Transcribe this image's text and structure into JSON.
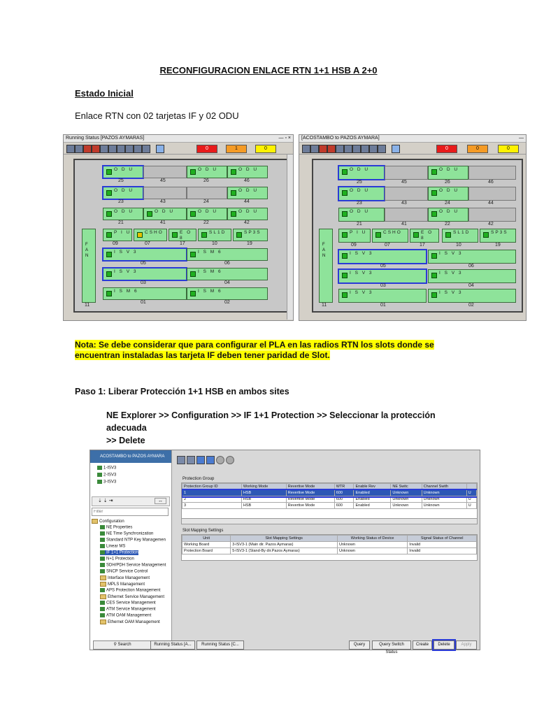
{
  "doc": {
    "title": "RECONFIGURACION ENLACE RTN 1+1 HSB A 2+0",
    "section1": "Estado Inicial",
    "para1": "Enlace RTN con 02 tarjetas IF y 02 ODU",
    "nota_line1": "Nota: Se debe considerar que para configurar el PLA en las radios RTN los slots donde se",
    "nota_line2": "encuentran instaladas las tarjeta IF deben tener paridad de Slot.",
    "paso1": "Paso 1: Liberar Protección 1+1 HSB en ambos sites",
    "nav_line1": "NE Explorer >> Configuration >> IF 1+1 Protection >> Seleccionar la protección adecuada",
    "nav_line2": ">> Delete"
  },
  "left_panel": {
    "title": "Running Status [PAZOS AYMARAS]",
    "controls": "— ▫ ×",
    "alarm_counts": [
      "0",
      "1",
      "0"
    ],
    "fan_label": "F A N",
    "slot_11": "11",
    "cards": {
      "c25": "O D U",
      "n25": "25",
      "n45": "45",
      "c26": "O D U",
      "n26": "26",
      "c46": "O D U",
      "n46": "46",
      "c23": "O D U",
      "n23": "23",
      "n43": "43",
      "n24": "24",
      "c44": "O D U",
      "n44": "44",
      "c21": "O D U",
      "n21": "21",
      "c41": "O D U",
      "n41": "41",
      "c22": "O D U",
      "n22": "22",
      "c42": "O D U",
      "n42": "42",
      "c09": "P I U",
      "n09": "09",
      "c07": "CSHO",
      "n07": "07",
      "c17": "E O 8",
      "n17": "17",
      "c10": "SL1D",
      "n10": "10",
      "c19": "SP3S",
      "n19": "19",
      "c05": "I S V 3",
      "n05": "05",
      "c06": "I S M 6",
      "n06": "06",
      "c03": "I S V 3",
      "n03": "03",
      "c04": "I S M 6",
      "n04": "04",
      "c01": "I S M 6",
      "n01": "01",
      "c02": "I S M 6",
      "n02": "02"
    }
  },
  "right_panel": {
    "title": "[ACOSTAMBO to PAZOS AYMARA]",
    "controls": "—",
    "alarm_counts": [
      "0",
      "0",
      "0"
    ],
    "fan_label": "F A N",
    "slot_11": "11",
    "cards": {
      "c25": "O D U",
      "n25": "25",
      "n45": "45",
      "c26": "O D U",
      "n26": "26",
      "n46": "46",
      "c23": "O D U",
      "n23": "23",
      "n43": "43",
      "c24": "O D U",
      "n24": "24",
      "n44": "44",
      "c21": "O D U",
      "n21": "21",
      "n41": "41",
      "c22": "O D U",
      "n22": "22",
      "n42": "42",
      "c09": "P I U",
      "n09": "09",
      "c07": "CSHO",
      "n07": "07",
      "c17": "E O 8",
      "n17": "17",
      "c10": "SL1D",
      "n10": "10",
      "c19": "SP3S",
      "n19": "19",
      "c05": "I S V 3",
      "n05": "05",
      "c06": "I S V 3",
      "n06": "06",
      "c03": "I S V 3",
      "n03": "03",
      "c04": "I S V 3",
      "n04": "04",
      "c01": "I S V 3",
      "n01": "01",
      "c02": "I S V 3",
      "n02": "02"
    }
  },
  "nms": {
    "ne_name": "ACOSTAMBO to PAZOS AYMARA",
    "boards": [
      "1-ISV3",
      "2-ISV3",
      "3-ISV3"
    ],
    "filter_placeholder": "Filter",
    "tree": [
      "Configuration",
      "NE Properties",
      "NE Time Synchronization",
      "Standard NTP Key Managemen",
      "Linear MS",
      "IF 1+1 Protection",
      "N+1 Protection",
      "SDH/PDH Service Management",
      "SNCP Service Control",
      "Interface Management",
      "MPLS Management",
      "APS Protection Management",
      "Ethernet Service Management",
      "CES Service Management",
      "ATM Service Management",
      "ATM OAM Management",
      "Ethernet OAM Management"
    ],
    "pg_label": "Protection Group",
    "pg_headers": [
      "Protection Group ID",
      "Working Mode",
      "Revertive Mode",
      "WTR",
      "Enable Rev",
      "NE Switc",
      "Channel Swith",
      ""
    ],
    "pg_rows": [
      [
        "1",
        "HSB",
        "Revertive Mode",
        "600",
        "Enabled",
        "Unknown",
        "Unknown",
        "U"
      ],
      [
        "2",
        "HSB",
        "Revertive Mode",
        "600",
        "Enabled",
        "Unknown",
        "Unknown",
        "U"
      ],
      [
        "3",
        "HSB",
        "Revertive Mode",
        "600",
        "Enabled",
        "Unknown",
        "Unknown",
        "U"
      ]
    ],
    "sm_label": "Slot Mapping Settings",
    "sm_headers": [
      "Unit",
      "Slot Mapping Settings",
      "Working Status of Device",
      "Signal Status of Channel"
    ],
    "sm_rows": [
      [
        "Working Board",
        "3-ISV3-1 (Main dir. Pazos Aymaras)",
        "Unknown",
        "Invalid"
      ],
      [
        "Protection Board",
        "5-ISV3-1 (Stand-By dir.Pazos Aymaras)",
        "Unknown",
        "Invalid"
      ]
    ],
    "btn_search": "Search",
    "tab1": "Running Status [A...",
    "tab2": "Running Status [C...",
    "buttons": [
      "Query",
      "Query Switch Status",
      "Create",
      "Delete",
      "Apply"
    ],
    "colors": {
      "title_bar": "#3d6fa8",
      "selection": "#2d58b5",
      "card_green": "#8ee39a",
      "highlight": "#ffff00"
    }
  }
}
